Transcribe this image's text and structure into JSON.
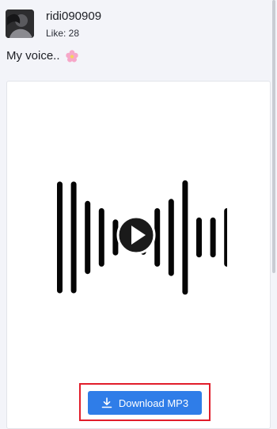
{
  "post": {
    "username": "ridi090909",
    "likes_text": "Like: 28",
    "caption": "My voice..",
    "caption_emoji": "flower-emoji"
  },
  "media": {
    "play_icon": "play-icon",
    "waveform_levels": [
      0.84,
      0.84,
      0.55,
      0.44,
      0.27,
      0.18,
      0.26,
      0.44,
      0.58,
      0.86,
      0.3,
      0.3,
      0.44
    ]
  },
  "download": {
    "label": "Download MP3",
    "icon": "download-icon"
  },
  "colors": {
    "accent": "#2f7de8",
    "highlight": "#e11d2a"
  }
}
